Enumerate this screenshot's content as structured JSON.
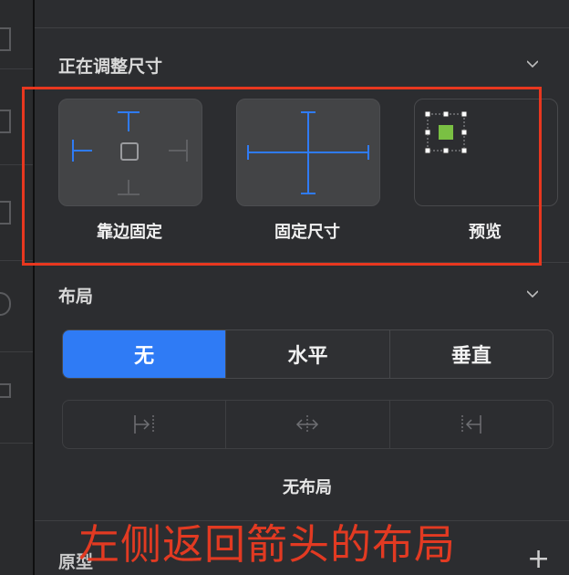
{
  "sizing": {
    "title": "正在调整尺寸",
    "options": [
      {
        "label": "靠边固定",
        "icon": "pin-edges-icon"
      },
      {
        "label": "固定尺寸",
        "icon": "fixed-size-icon"
      },
      {
        "label": "预览",
        "icon": "preview-icon"
      }
    ]
  },
  "layout": {
    "title": "布局",
    "segments": [
      "无",
      "水平",
      "垂直"
    ],
    "selected": "无",
    "direction_buttons": [
      "align-left-icon",
      "align-center-icon",
      "align-right-icon"
    ],
    "status": "无布局"
  },
  "prototype": {
    "title": "原型"
  },
  "annotation": {
    "text": "左侧返回箭头的布局",
    "color": "#e8371f"
  },
  "colors": {
    "accent": "#2f7bf5",
    "preview_fill": "#7ac043",
    "icon_blue": "#2f7bf5"
  }
}
